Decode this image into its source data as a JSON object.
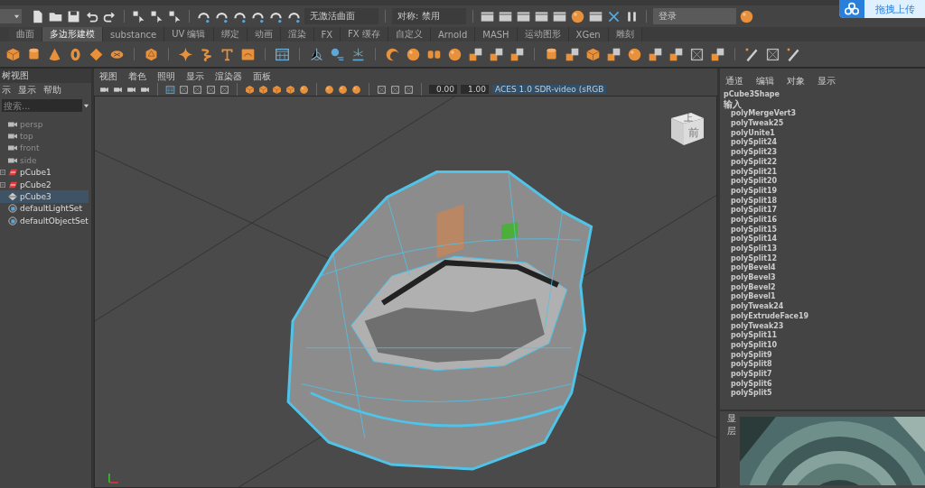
{
  "status_line": {
    "curve_field": "无激活曲面",
    "symmetry_field": "对称: 禁用",
    "login": "登录"
  },
  "upload_button": {
    "label": "拖拽上传"
  },
  "shelf_tabs": [
    {
      "label": "曲面",
      "selected": false
    },
    {
      "label": "多边形建模",
      "selected": true
    },
    {
      "label": "substance",
      "selected": false
    },
    {
      "label": "UV 编辑",
      "selected": false
    },
    {
      "label": "绑定",
      "selected": false
    },
    {
      "label": "动画",
      "selected": false
    },
    {
      "label": "渲染",
      "selected": false
    },
    {
      "label": "FX",
      "selected": false
    },
    {
      "label": "FX 缓存",
      "selected": false
    },
    {
      "label": "自定义",
      "selected": false
    },
    {
      "label": "Arnold",
      "selected": false
    },
    {
      "label": "MASH",
      "selected": false
    },
    {
      "label": "运动图形",
      "selected": false
    },
    {
      "label": "XGen",
      "selected": false
    },
    {
      "label": "雕刻",
      "selected": false
    }
  ],
  "outliner": {
    "title": "树视图",
    "menus": [
      "示",
      "显示",
      "帮助"
    ],
    "search": {
      "placeholder": "搜索..."
    },
    "items": [
      {
        "label": "persp",
        "kind": "camera",
        "disabled": true,
        "has_children": false,
        "selected": false
      },
      {
        "label": "top",
        "kind": "camera",
        "disabled": true,
        "has_children": false,
        "selected": false
      },
      {
        "label": "front",
        "kind": "camera",
        "disabled": true,
        "has_children": false,
        "selected": false
      },
      {
        "label": "side",
        "kind": "camera",
        "disabled": true,
        "has_children": false,
        "selected": false
      },
      {
        "label": "pCube1",
        "kind": "mesh",
        "disabled": false,
        "has_children": true,
        "selected": false
      },
      {
        "label": "pCube2",
        "kind": "mesh",
        "disabled": false,
        "has_children": true,
        "selected": false
      },
      {
        "label": "pCube3",
        "kind": "poly",
        "disabled": false,
        "has_children": false,
        "selected": true
      },
      {
        "label": "defaultLightSet",
        "kind": "set",
        "disabled": false,
        "has_children": false,
        "selected": false
      },
      {
        "label": "defaultObjectSet",
        "kind": "set",
        "disabled": false,
        "has_children": false,
        "selected": false
      }
    ]
  },
  "viewport": {
    "menus": [
      "视图",
      "着色",
      "照明",
      "显示",
      "渲染器",
      "面板"
    ],
    "exposure": "0.00",
    "gamma": "1.00",
    "color_space": "ACES 1.0 SDR-video (sRGB",
    "view_cube": {
      "top": "上",
      "front": "前"
    }
  },
  "channel_box": {
    "menus": [
      "通道",
      "编辑",
      "对象",
      "显示"
    ],
    "node": "pCube3Shape",
    "inputs_label": "输入",
    "inputs": [
      "polyMergeVert3",
      "polyTweak25",
      "polyUnite1",
      "polySplit24",
      "polySplit23",
      "polySplit22",
      "polySplit21",
      "polySplit20",
      "polySplit19",
      "polySplit18",
      "polySplit17",
      "polySplit16",
      "polySplit15",
      "polySplit14",
      "polySplit13",
      "polySplit12",
      "polyBevel4",
      "polyBevel3",
      "polyBevel2",
      "polyBevel1",
      "polyTweak24",
      "polyExtrudeFace19",
      "polyTweak23",
      "polySplit11",
      "polySplit10",
      "polySplit9",
      "polySplit8",
      "polySplit7",
      "polySplit6",
      "polySplit5"
    ]
  },
  "layer_editor": {
    "tab": "显",
    "label": "层"
  }
}
